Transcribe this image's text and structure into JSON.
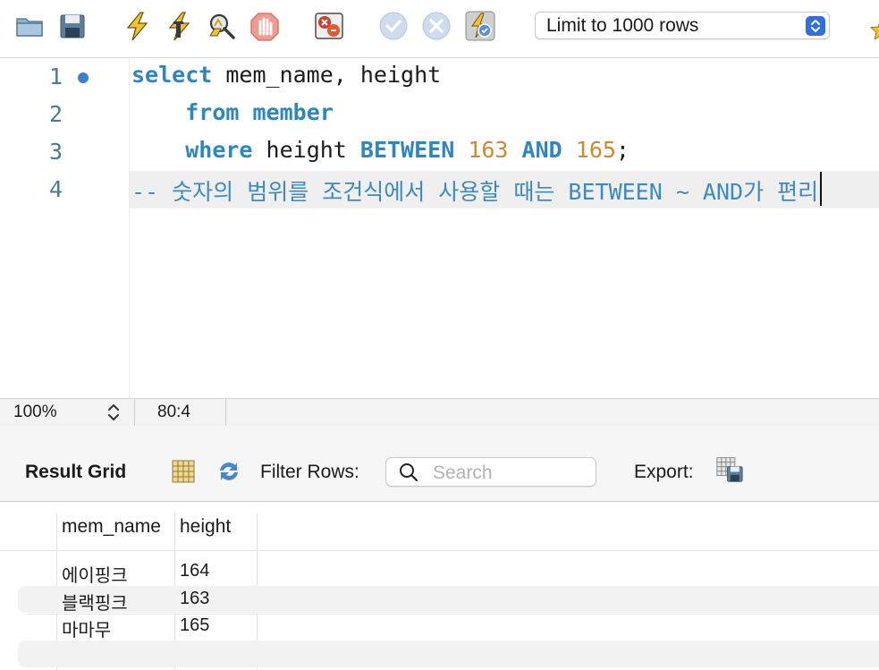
{
  "toolbar": {
    "buttons": [
      {
        "name": "open-folder-icon"
      },
      {
        "name": "save-script-icon"
      },
      {
        "name": "execute-icon"
      },
      {
        "name": "execute-current-icon"
      },
      {
        "name": "explain-icon"
      },
      {
        "name": "stop-icon"
      },
      {
        "name": "toggle-error-icon"
      },
      {
        "name": "commit-icon"
      },
      {
        "name": "rollback-icon"
      },
      {
        "name": "autocommit-icon"
      }
    ],
    "limit_select": "Limit to 1000 rows"
  },
  "editor": {
    "line_numbers": [
      "1",
      "2",
      "3",
      "4"
    ],
    "lines": {
      "l1": {
        "kw": "select",
        "rest": " mem_name, height"
      },
      "l2": {
        "indent": "    ",
        "kw1": "from",
        "space": " ",
        "kw2": "member"
      },
      "l3": {
        "indent": "    ",
        "kw1": "where",
        "text": " height ",
        "kw2": "BETWEEN",
        "num1": "163",
        "kw3": "AND",
        "num2": "165",
        "end": ";"
      },
      "l4": {
        "comment": "-- 숫자의 범위를 조건식에서 사용할 때는 BETWEEN ~ AND가 편리"
      }
    }
  },
  "status": {
    "zoom": "100%",
    "cursor": "80:4"
  },
  "result": {
    "title": "Result Grid",
    "filter_label": "Filter Rows:",
    "search_placeholder": "Search",
    "export_label": "Export:",
    "columns": [
      "mem_name",
      "height"
    ],
    "rows": [
      [
        "에이핑크",
        "164"
      ],
      [
        "블랙핑크",
        "163"
      ],
      [
        "마마무",
        "165"
      ]
    ]
  }
}
